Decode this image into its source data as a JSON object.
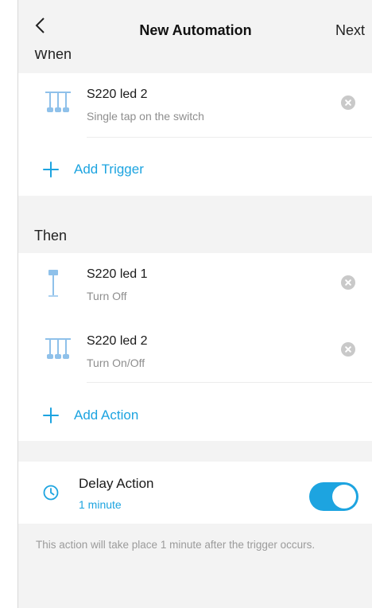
{
  "header": {
    "title": "New Automation",
    "next_label": "Next"
  },
  "when": {
    "label": "When",
    "triggers": [
      {
        "name": "S220 led 2",
        "detail": "Single tap on the switch",
        "icon": "triple-light-icon"
      }
    ],
    "add_label": "Add Trigger"
  },
  "then": {
    "label": "Then",
    "actions": [
      {
        "name": "S220 led 1",
        "detail": "Turn Off",
        "icon": "pendant-lamp-icon"
      },
      {
        "name": "S220 led 2",
        "detail": "Turn On/Off",
        "icon": "triple-light-icon"
      }
    ],
    "add_label": "Add Action"
  },
  "delay": {
    "title": "Delay Action",
    "value": "1 minute",
    "enabled": true
  },
  "hint": "This action will take place 1 minute after the trigger occurs.",
  "colors": {
    "accent": "#1da4e0",
    "background": "#f3f3f3",
    "secondary_text": "#8e8e8e"
  }
}
